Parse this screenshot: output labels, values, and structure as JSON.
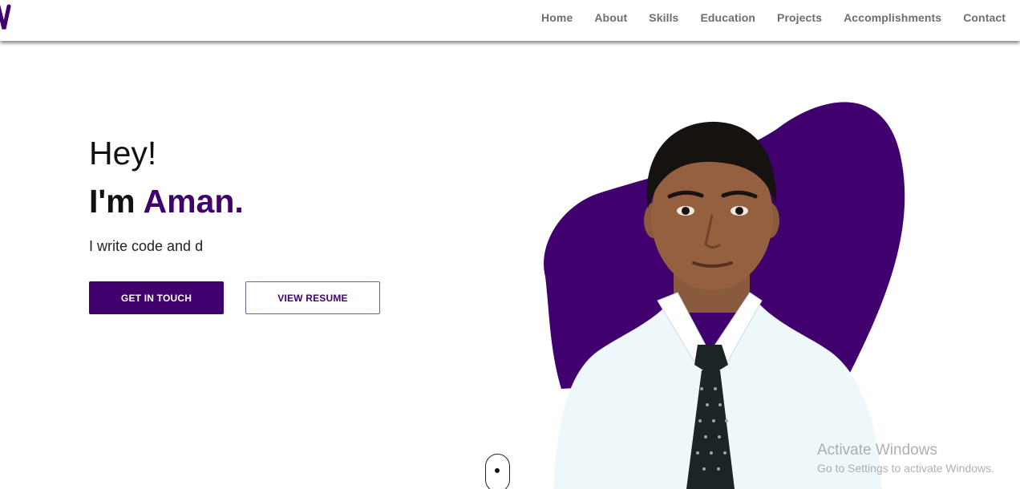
{
  "nav": {
    "items": [
      "Home",
      "About",
      "Skills",
      "Education",
      "Projects",
      "Accomplishments",
      "Contact"
    ]
  },
  "hero": {
    "greeting": "Hey!",
    "intro_prefix": "I'm",
    "name": "Aman.",
    "typed_text": "I write code and d",
    "primary_button": "GET IN TOUCH",
    "secondary_button": "VIEW RESUME"
  },
  "watermark": {
    "title": "Activate Windows",
    "subtitle": "Go to Settings to activate Windows."
  },
  "colors": {
    "accent": "#40006d",
    "nav_text": "#6e6e6e",
    "background": "#ffffff"
  },
  "icons": {
    "logo": "logo-mark-icon",
    "scroll": "scroll-mouse-icon"
  }
}
